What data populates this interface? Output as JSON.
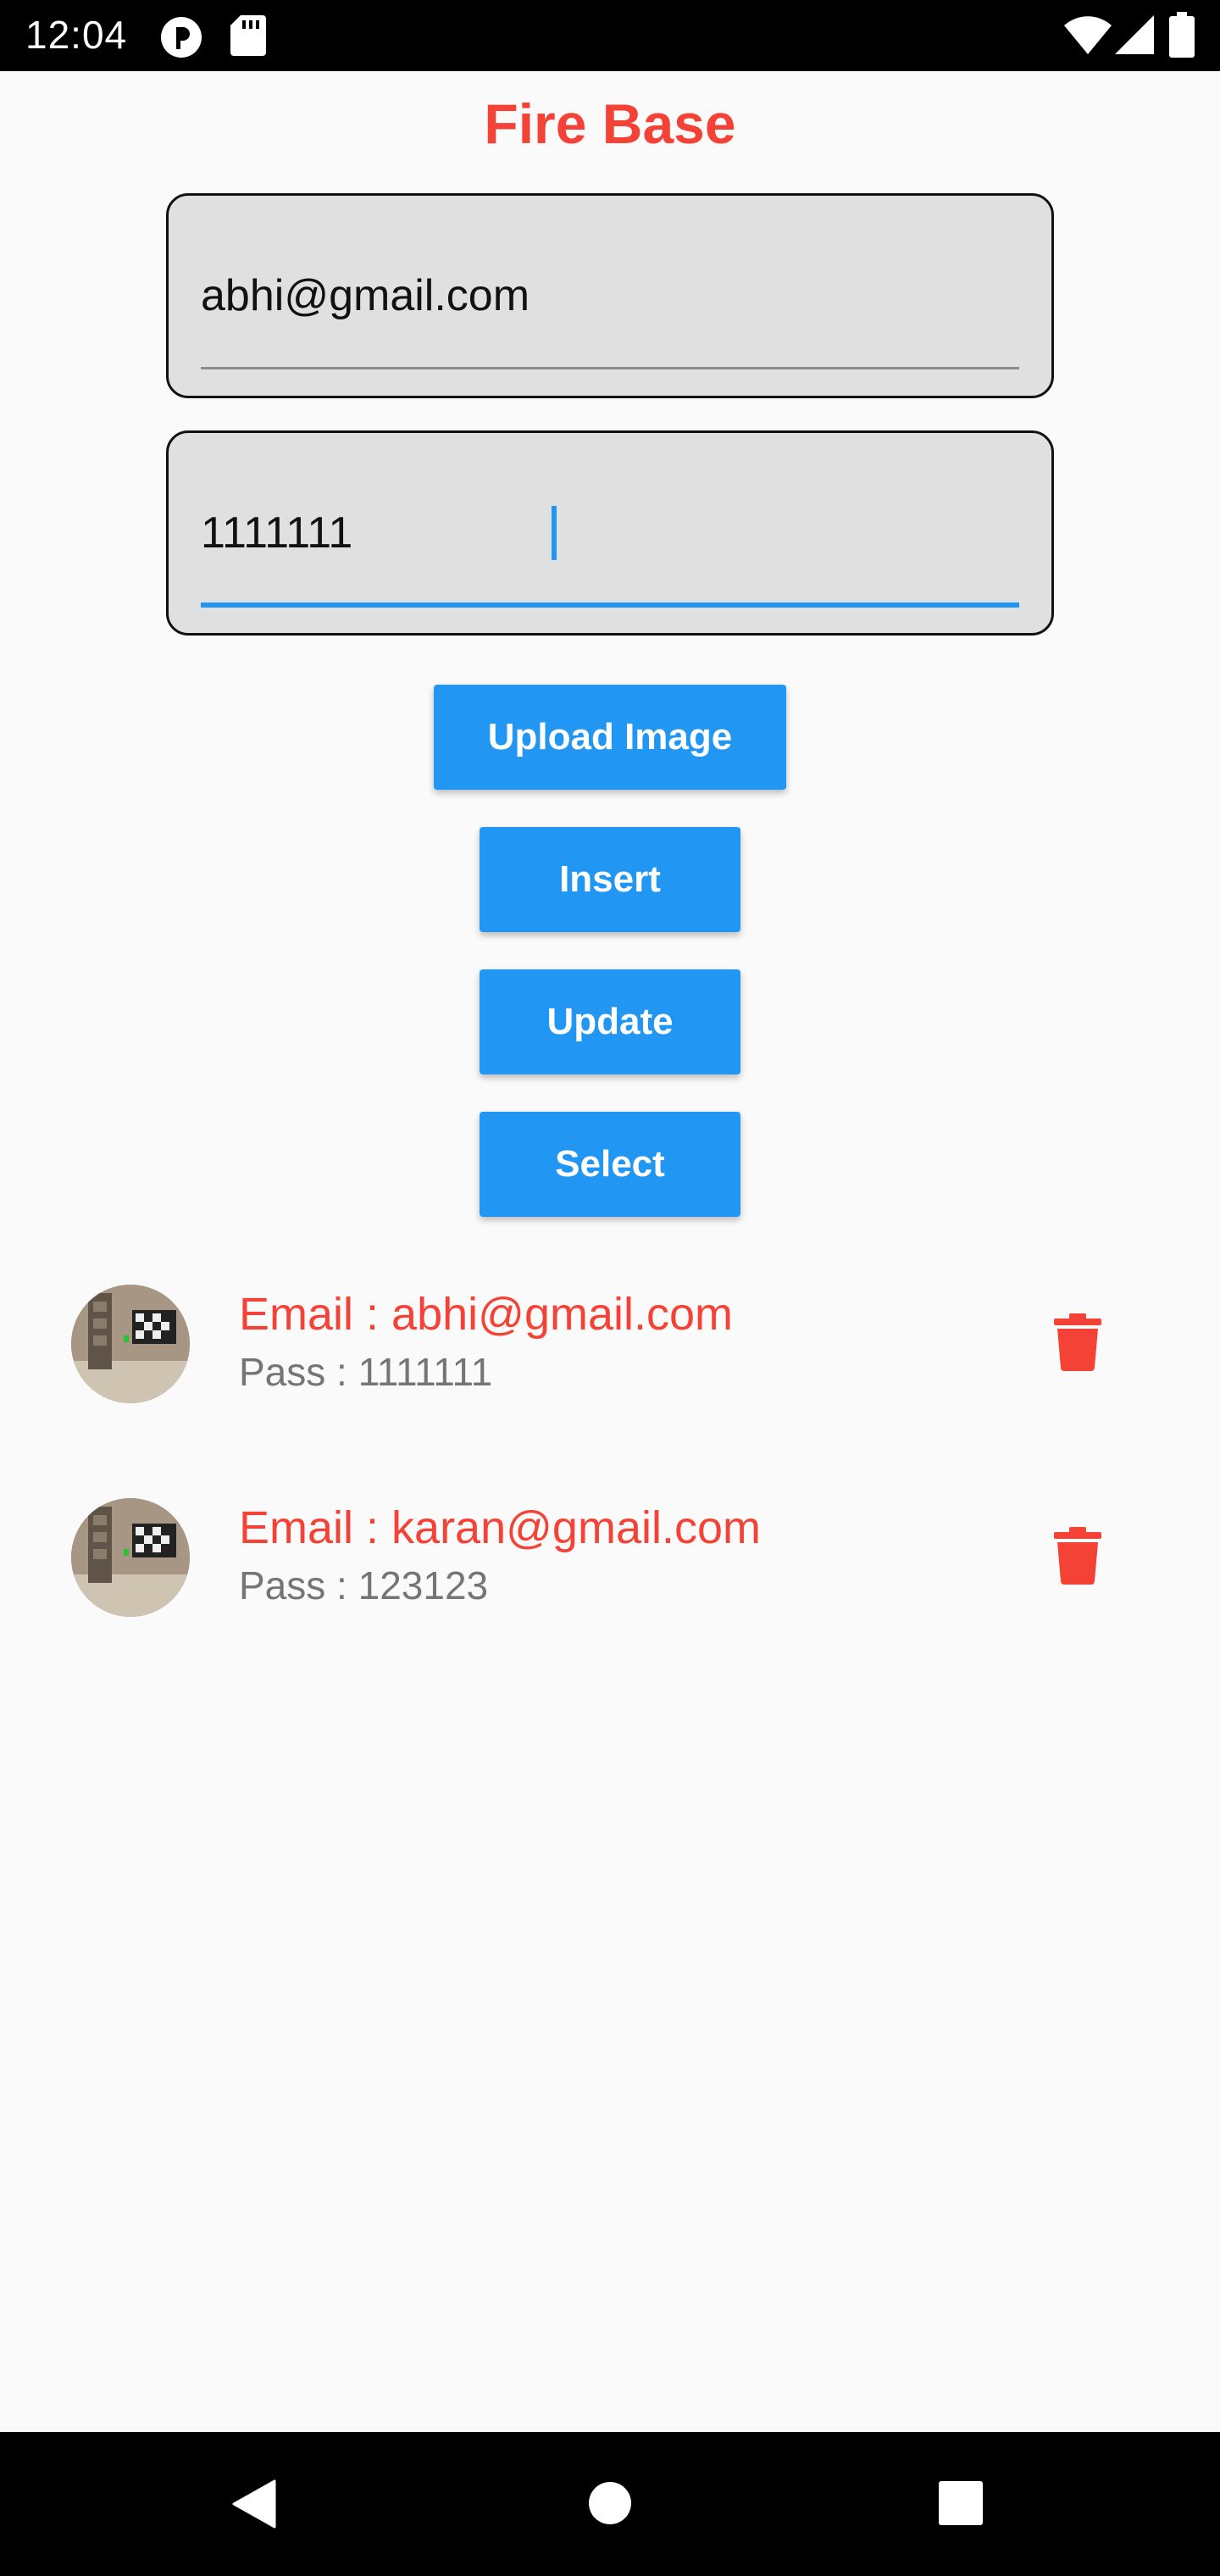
{
  "status_bar": {
    "time": "12:04",
    "icons": [
      "p-icon",
      "sd-card-icon",
      "wifi-icon",
      "signal-icon",
      "battery-icon"
    ]
  },
  "app": {
    "title": "Fire Base",
    "accent_color": "#f44336",
    "primary_color": "#2196f3"
  },
  "form": {
    "email_value": "abhi@gmail.com",
    "password_value": "1111111"
  },
  "buttons": {
    "upload": "Upload Image",
    "insert": "Insert",
    "update": "Update",
    "select": "Select"
  },
  "records": [
    {
      "email": "Email : abhi@gmail.com",
      "pass": "Pass : 1111111"
    },
    {
      "email": "Email : karan@gmail.com",
      "pass": "Pass : 123123"
    }
  ],
  "nav_bar": {
    "icons": [
      "back-icon",
      "home-icon",
      "recents-icon"
    ]
  }
}
